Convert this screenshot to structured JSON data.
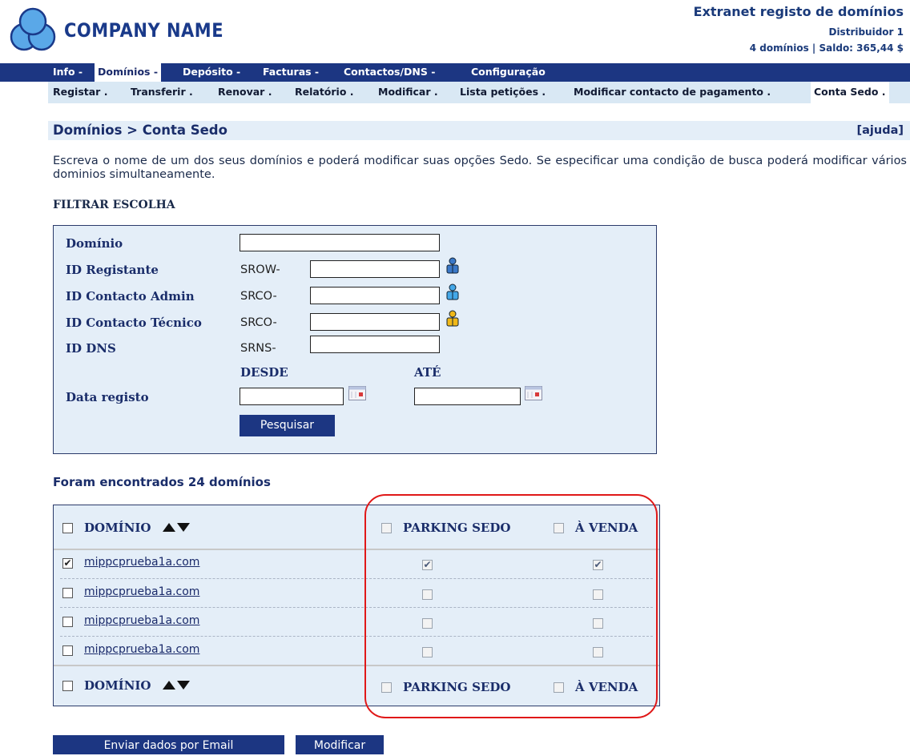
{
  "header": {
    "company_name": "COMPANY NAME",
    "extranet_title": "Extranet registo de domínios",
    "distributor": "Distribuidor 1",
    "account_info": "4 domínios | Saldo: 365,44 $"
  },
  "nav_main": [
    "Info -",
    "Domínios -",
    "Depósito -",
    "Facturas -",
    "Contactos/DNS -",
    "Configuração"
  ],
  "nav_main_active": "Domínios -",
  "nav_sub": [
    "Registar .",
    "Transferir .",
    "Renovar .",
    "Relatório .",
    "Modificar .",
    "Lista petições .",
    "Modificar contacto de pagamento .",
    "Conta Sedo ."
  ],
  "nav_sub_active": "Conta Sedo .",
  "breadcrumb": "Domínios > Conta Sedo",
  "help_link": "[ajuda]",
  "intro": "Escreva o nome de um dos seus domínios e poderá modificar suas opções Sedo. Se especificar uma condição de busca poderá modificar vários dominios simultaneamente.",
  "filter": {
    "heading": "FILTRAR ESCOLHA",
    "domain_label": "Domínio",
    "domain_value": "",
    "registrant_label": "ID Registante",
    "registrant_prefix": "SROW-",
    "registrant_value": "",
    "admin_label": "ID Contacto Admin",
    "admin_prefix": "SRCO-",
    "admin_value": "",
    "tech_label": "ID Contacto Técnico",
    "tech_prefix": "SRCO-",
    "tech_value": "",
    "dns_label": "ID DNS",
    "dns_prefix": "SRNS-",
    "dns_value": "",
    "from_label": "DESDE",
    "to_label": "ATÉ",
    "date_label": "Data registo",
    "from_value": "",
    "to_value": "",
    "search_button": "Pesquisar"
  },
  "results": {
    "found_text": "Foram encontrados 24 domínios",
    "col_domain": "DOMÍNIO",
    "col_parking": "PARKING SEDO",
    "col_sale": "À VENDA",
    "rows": [
      {
        "domain": "mippcprueba1a.com",
        "selected": true,
        "parking": true,
        "sale": true
      },
      {
        "domain": "mippcprueba1a.com",
        "selected": false,
        "parking": false,
        "sale": false
      },
      {
        "domain": "mippcprueba1a.com",
        "selected": false,
        "parking": false,
        "sale": false
      },
      {
        "domain": "mippcprueba1a.com",
        "selected": false,
        "parking": false,
        "sale": false
      }
    ]
  },
  "buttons": {
    "email": "Enviar dados por Email",
    "modify": "Modificar"
  },
  "colors": {
    "nav_bg": "#1c3682",
    "sub_nav_bg": "#d9e8f4",
    "panel_bg": "#e4eef8",
    "highlight": "#e01818"
  }
}
